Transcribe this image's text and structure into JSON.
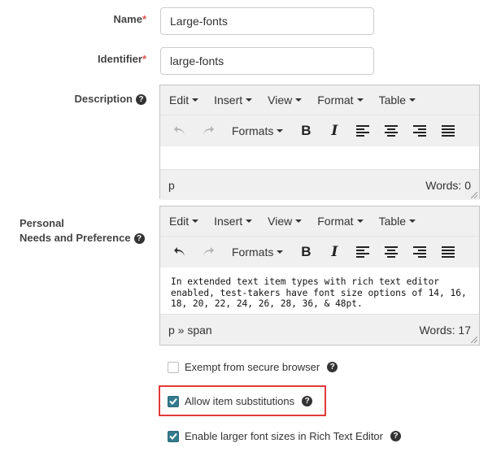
{
  "name_field": {
    "label": "Name",
    "required_mark": "*",
    "value": "Large-fonts"
  },
  "identifier_field": {
    "label": "Identifier",
    "required_mark": "*",
    "value": "large-fonts"
  },
  "description_field": {
    "label": "Description",
    "help": "?",
    "menus": [
      "Edit",
      "Insert",
      "View",
      "Format",
      "Table"
    ],
    "formats_label": "Formats",
    "content": "",
    "path": "p",
    "word_count": "Words: 0"
  },
  "personal_needs_field": {
    "label_line1": "Personal",
    "label_line2": "Needs and Preference",
    "help": "?",
    "menus": [
      "Edit",
      "Insert",
      "View",
      "Format",
      "Table"
    ],
    "formats_label": "Formats",
    "content": "In extended text item types with rich text editor enabled, test-takers have font size options of 14, 16, 18, 20, 22, 24, 26, 28, 36, & 48pt.",
    "path": "p » span",
    "word_count": "Words: 17"
  },
  "checkboxes": [
    {
      "label": "Exempt from secure browser",
      "checked": false,
      "help": "?"
    },
    {
      "label": "Allow item substitutions",
      "checked": true,
      "help": "?"
    },
    {
      "label": "Enable larger font sizes in Rich Text Editor",
      "checked": true,
      "help": "?"
    }
  ],
  "toolbar_icons": [
    "undo-icon",
    "redo-icon",
    "bold-icon",
    "italic-icon",
    "align-left-icon",
    "align-center-icon",
    "align-right-icon",
    "align-justify-icon"
  ],
  "colors": {
    "checkbox_checked": "#337a8c",
    "highlight_border": "#e03a3a",
    "required": "#d9534f",
    "toolbar_bg": "#f0f0f0"
  },
  "toolbar_glyphs": {
    "bold": "B",
    "italic": "I"
  }
}
